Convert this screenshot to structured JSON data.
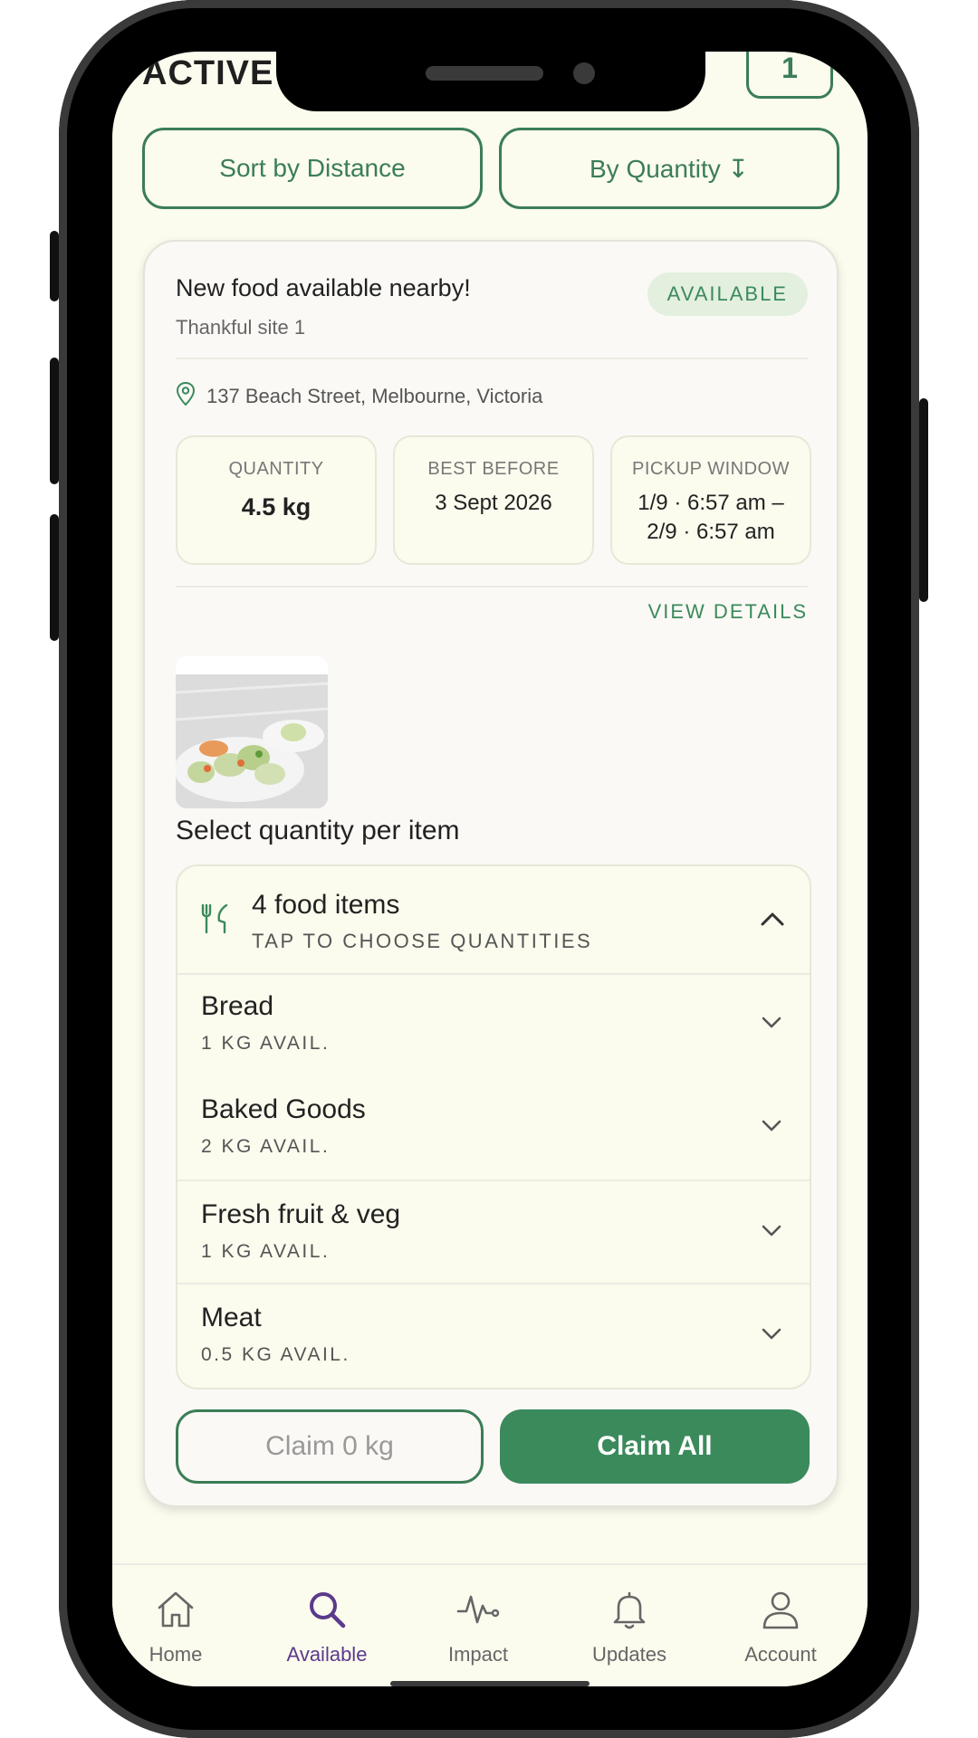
{
  "header": {
    "brand": "ACTIVE",
    "count": "1"
  },
  "sort": {
    "distance_label": "Sort by Distance",
    "quantity_label": "By Quantity ↧"
  },
  "listing": {
    "title": "New food available nearby!",
    "site": "Thankful site 1",
    "status": "AVAILABLE",
    "address": "137 Beach Street, Melbourne, Victoria",
    "quantity": {
      "label": "QUANTITY",
      "value": "4.5 kg"
    },
    "best_before": {
      "label": "BEST BEFORE",
      "value": "3 Sept 2026"
    },
    "pickup": {
      "label": "PICKUP WINDOW",
      "line1": "1/9 · 6:57 am –",
      "line2": "2/9 · 6:57 am"
    },
    "view_details": "VIEW DETAILS"
  },
  "selection": {
    "title": "Select quantity per item",
    "summary_title": "4 food items",
    "summary_sub": "TAP TO CHOOSE QUANTITIES",
    "items": [
      {
        "name": "Bread",
        "avail": "1 KG AVAIL."
      },
      {
        "name": "Baked Goods",
        "avail": "2 KG AVAIL."
      },
      {
        "name": "Fresh fruit & veg",
        "avail": "1 KG AVAIL."
      },
      {
        "name": "Meat",
        "avail": "0.5 KG AVAIL."
      }
    ]
  },
  "actions": {
    "claim_label": "Claim 0 kg",
    "claim_all_label": "Claim All"
  },
  "nav": {
    "items": [
      {
        "label": "Home",
        "icon": "home-icon"
      },
      {
        "label": "Available",
        "icon": "search-icon"
      },
      {
        "label": "Impact",
        "icon": "pulse-icon"
      },
      {
        "label": "Updates",
        "icon": "bell-icon"
      },
      {
        "label": "Account",
        "icon": "user-icon"
      }
    ],
    "active": "Available"
  },
  "colors": {
    "accent": "#3b8a5c",
    "background": "#fbfbee",
    "active_nav": "#5b3a8c"
  }
}
